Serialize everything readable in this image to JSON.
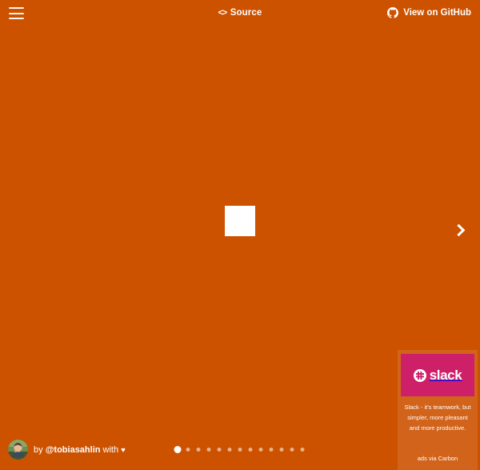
{
  "page": {
    "background_color": "#cc5200",
    "text_color": "#ffffff"
  },
  "header": {
    "menu_label": "Menu",
    "source": {
      "icon": "code-brackets-icon",
      "icon_glyph": "<>",
      "label": "Source"
    },
    "github": {
      "icon": "github-icon",
      "label": "View on GitHub"
    }
  },
  "stage": {
    "loader": {
      "name": "square-loader",
      "state": "animating"
    },
    "next_button": {
      "icon": "chevron-right-icon",
      "label": "Next"
    }
  },
  "ad": {
    "provider": "Carbon",
    "brand": "slack",
    "banner_color": "#cd2069",
    "text": "Slack - it's teamwork, but simpler, more pleasant and more productive.",
    "poweredby": "ads via Carbon"
  },
  "footer": {
    "byline": {
      "prefix": "by",
      "handle": "@tobiasahlin",
      "suffix": "with",
      "heart": "♥"
    },
    "pagination": {
      "active_index": 0,
      "total": 13,
      "dots": [
        {
          "index": 1,
          "active": true
        },
        {
          "index": 2,
          "active": false
        },
        {
          "index": 3,
          "active": false
        },
        {
          "index": 4,
          "active": false
        },
        {
          "index": 5,
          "active": false
        },
        {
          "index": 6,
          "active": false
        },
        {
          "index": 7,
          "active": false
        },
        {
          "index": 8,
          "active": false
        },
        {
          "index": 9,
          "active": false
        },
        {
          "index": 10,
          "active": false
        },
        {
          "index": 11,
          "active": false
        },
        {
          "index": 12,
          "active": false
        },
        {
          "index": 13,
          "active": false
        }
      ]
    }
  }
}
